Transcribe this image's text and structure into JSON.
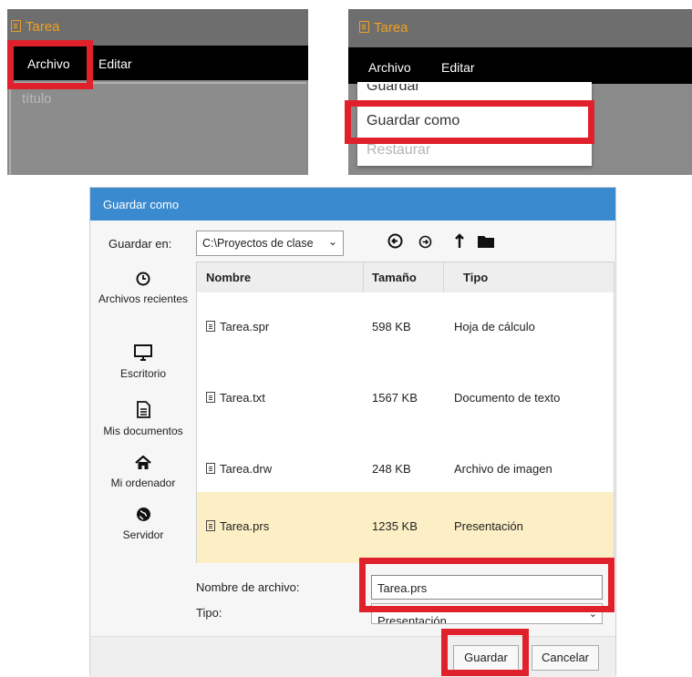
{
  "panel1": {
    "title": "Tarea",
    "menu": [
      "Archivo",
      "Editar"
    ],
    "title_placeholder": "título"
  },
  "panel2": {
    "title": "Tarea",
    "menu": [
      "Archivo",
      "Editar"
    ],
    "dropdown": [
      "Guardar",
      "Guardar como",
      "Restaurar"
    ]
  },
  "dialog": {
    "title": "Guardar como",
    "save_in_label": "Guardar en:",
    "save_in_value": "C:\\Proyectos de clase",
    "nav": [
      {
        "label": "Archivos recientes",
        "icon": "clock-icon"
      },
      {
        "label": "Escritorio",
        "icon": "monitor-icon"
      },
      {
        "label": "Mis documentos",
        "icon": "document-icon"
      },
      {
        "label": "Mi ordenador",
        "icon": "home-icon"
      },
      {
        "label": "Servidor",
        "icon": "globe-icon"
      }
    ],
    "columns": [
      "Nombre",
      "Tamaño",
      "Tipo"
    ],
    "files": [
      {
        "name": "Tarea.spr",
        "size": "598 KB",
        "type": "Hoja de cálculo"
      },
      {
        "name": "Tarea.txt",
        "size": "1567 KB",
        "type": "Documento de texto"
      },
      {
        "name": "Tarea.drw",
        "size": "248 KB",
        "type": "Archivo de imagen"
      },
      {
        "name": "Tarea.prs",
        "size": "1235 KB",
        "type": "Presentación"
      }
    ],
    "filename_label": "Nombre de archivo:",
    "filename_value": "Tarea.prs",
    "type_label": "Tipo:",
    "type_value": "Presentación",
    "save_button": "Guardar",
    "cancel_button": "Cancelar"
  },
  "colors": {
    "accent_orange": "#f0a020",
    "dialog_title_blue": "#3a8ad0",
    "highlight_red": "#e0202a",
    "selected_row": "#fcefc5"
  }
}
